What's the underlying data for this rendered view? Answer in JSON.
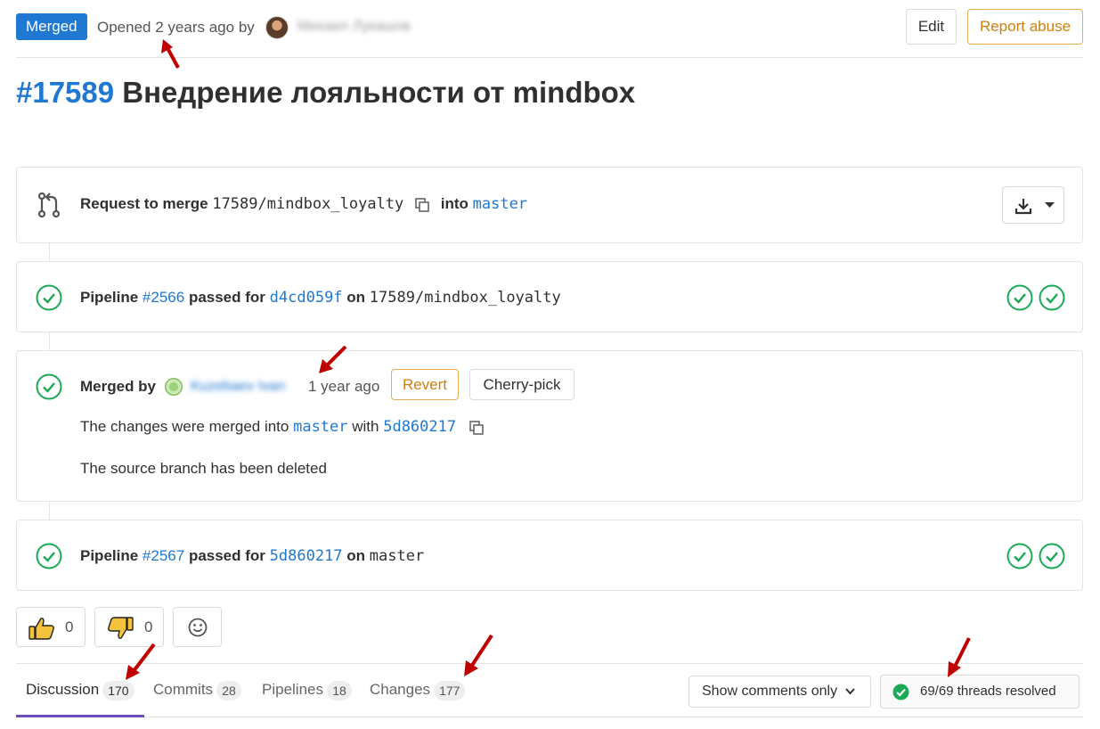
{
  "header": {
    "status_badge": "Merged",
    "opened_prefix": "Opened",
    "opened_time": "2 years ago",
    "opened_by": "by",
    "author_name": "Михаил Лукашов",
    "edit_label": "Edit",
    "report_label": "Report abuse"
  },
  "mr": {
    "number": "#17589",
    "title": "Внедрение лояльности от mindbox"
  },
  "merge_request_block": {
    "prefix": "Request to merge",
    "source_branch": "17589/mindbox_loyalty",
    "into": "into",
    "target_branch": "master"
  },
  "pipeline_1": {
    "label": "Pipeline",
    "id": "#2566",
    "passed_for": "passed for",
    "commit": "d4cd059f",
    "on": "on",
    "branch": "17589/mindbox_loyalty"
  },
  "merged_block": {
    "merged_by": "Merged by",
    "merger_name": "Kuzebaev Ivan",
    "time": "1 year ago",
    "revert_label": "Revert",
    "cherry_pick_label": "Cherry-pick",
    "changes_text": "The changes were merged into",
    "target_branch": "master",
    "with": "with",
    "commit": "5d860217",
    "source_deleted": "The source branch has been deleted"
  },
  "pipeline_2": {
    "label": "Pipeline",
    "id": "#2567",
    "passed_for": "passed for",
    "commit": "5d860217",
    "on": "on",
    "branch": "master"
  },
  "reactions": {
    "thumbs_up_count": "0",
    "thumbs_down_count": "0"
  },
  "tabs": [
    {
      "label": "Discussion",
      "count": "170",
      "active": true
    },
    {
      "label": "Commits",
      "count": "28"
    },
    {
      "label": "Pipelines",
      "count": "18"
    },
    {
      "label": "Changes",
      "count": "177"
    }
  ],
  "toolbar": {
    "show_comments": "Show comments only",
    "threads_resolved": "69/69 threads resolved"
  },
  "colors": {
    "accent": "#1f78d1",
    "success": "#1aaa55",
    "warning": "#d07f0f",
    "annotation": "#c00000"
  }
}
